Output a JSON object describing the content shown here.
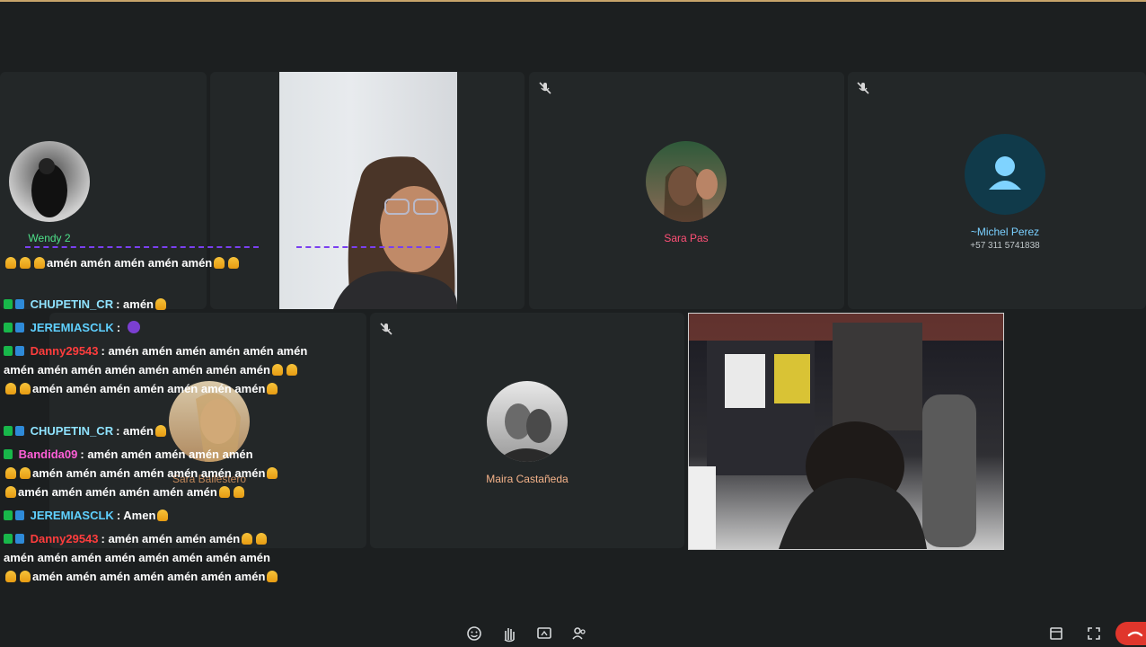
{
  "participants": {
    "wendy": {
      "name": "Wendy 2",
      "name_color": "#4ee18a"
    },
    "sara_pas": {
      "name": "Sara Pas",
      "name_color": "#ff4f76"
    },
    "michel": {
      "name": "~Michel Perez",
      "phone": "+57 311 5741838",
      "name_color": "#7ad0ff"
    },
    "maira": {
      "name": "Maira Castañeda",
      "name_color": "#f5b38a"
    },
    "sara_b": {
      "name": "Sara Ballestero",
      "name_color": "#f5a76b"
    }
  },
  "chat": {
    "row1": "amén amén amén amén amén",
    "m1": {
      "user": "CHUPETIN_CR",
      "color": "#8fe3ff",
      "text": ": amén"
    },
    "m2": {
      "user": "JEREMIASCLK",
      "color": "#5fd0ff",
      "text": ":"
    },
    "m3": {
      "user": "Danny29543",
      "color": "#ff3d3d",
      "text": ": amén amén amén amén amén amén"
    },
    "m3b": "amén amén amén amén amén amén amén amén",
    "m3c": "amén amén amén amén amén amén amén",
    "m4": {
      "user": "CHUPETIN_CR",
      "color": "#8fe3ff",
      "text": ": amén"
    },
    "m5": {
      "user": "Bandida09",
      "color": "#ff5fd8",
      "text": ": amén amén amén amén amén"
    },
    "m5b": "amén amén amén amén amén amén amén",
    "m5c": "amén amén amén amén amén amén",
    "m6": {
      "user": "JEREMIASCLK",
      "color": "#5fd0ff",
      "text": ": Amen"
    },
    "m7": {
      "user": "Danny29543",
      "color": "#ff3d3d",
      "text": ": amén amén amén amén"
    },
    "m7b": "amén amén amén amén amén amén amén amén",
    "m7c": "amén amén amén amén amén amén amén"
  },
  "icons": {
    "toolbar": [
      "emoji-icon",
      "raise-hand-icon",
      "share-screen-icon",
      "people-icon"
    ],
    "right": [
      "layout-icon",
      "fullscreen-icon",
      "end-call-icon"
    ],
    "end_call_color": "#e0362c"
  }
}
